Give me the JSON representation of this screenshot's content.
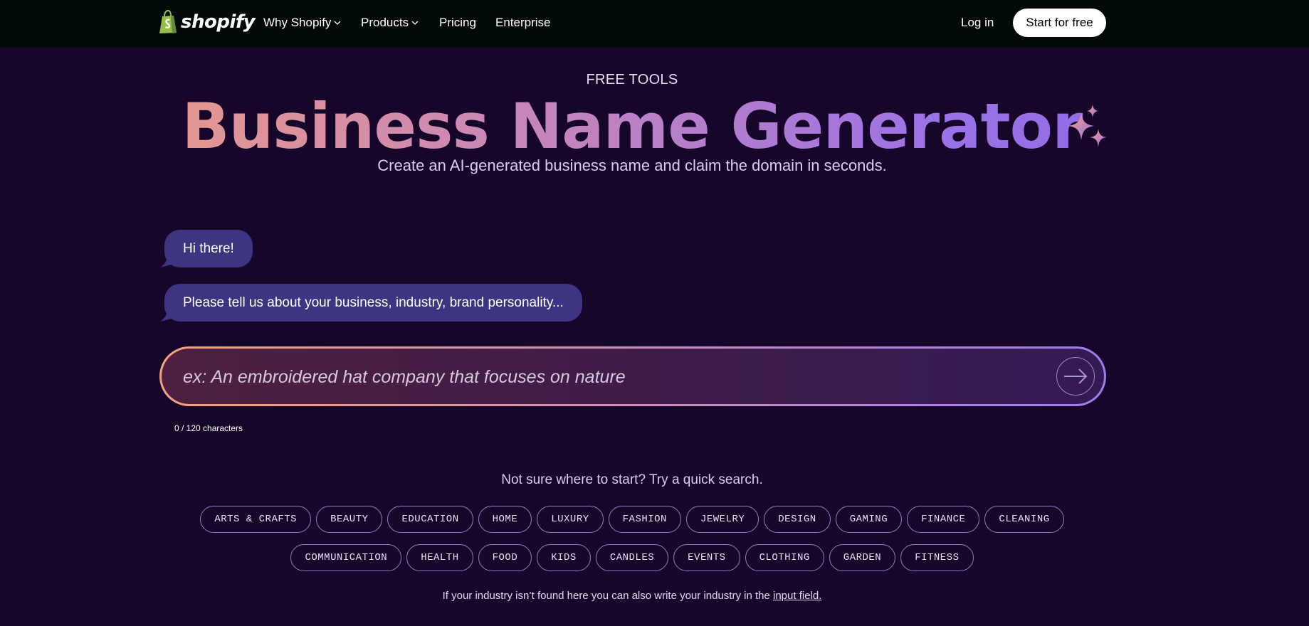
{
  "nav": {
    "brand": "shopify",
    "links": [
      {
        "label": "Why Shopify",
        "has_dropdown": true
      },
      {
        "label": "Products",
        "has_dropdown": true
      },
      {
        "label": "Pricing",
        "has_dropdown": false
      },
      {
        "label": "Enterprise",
        "has_dropdown": false
      }
    ],
    "login_label": "Log in",
    "signup_label": "Start for free"
  },
  "hero": {
    "eyebrow": "FREE TOOLS",
    "title": "Business Name Generator",
    "subtitle": "Create an AI-generated business name and claim the domain in seconds."
  },
  "chat": {
    "messages": [
      "Hi there!",
      "Please tell us about your business, industry, brand personality..."
    ],
    "input_value": "",
    "input_placeholder": "ex: An embroidered hat company that focuses on nature",
    "char_count": "0 / 120 characters"
  },
  "quick_search": {
    "title": "Not sure where to start? Try a quick search.",
    "row1": [
      "ARTS & CRAFTS",
      "BEAUTY",
      "EDUCATION",
      "HOME",
      "LUXURY",
      "FASHION",
      "JEWELRY",
      "DESIGN",
      "GAMING",
      "FINANCE",
      "CLEANING"
    ],
    "row2": [
      "COMMUNICATION",
      "HEALTH",
      "FOOD",
      "KIDS",
      "CANDLES",
      "EVENTS",
      "CLOTHING",
      "GARDEN",
      "FITNESS"
    ],
    "footnote": "If your industry isn’t found here you can also write your industry in the",
    "footnote_link": "input field."
  },
  "icons": {
    "logo": "shopify-bag-icon",
    "dropdown": "chevron-down-icon",
    "sparkle": "sparkle-icon",
    "submit": "arrow-right-icon"
  },
  "colors": {
    "page_bg": "#160629",
    "nav_bg": "#010a08",
    "bubble_bg": "#3e3582",
    "brand_green": "#95bf47",
    "title_gradient_start": "#f2a07a",
    "title_gradient_end": "#8b63e8"
  }
}
